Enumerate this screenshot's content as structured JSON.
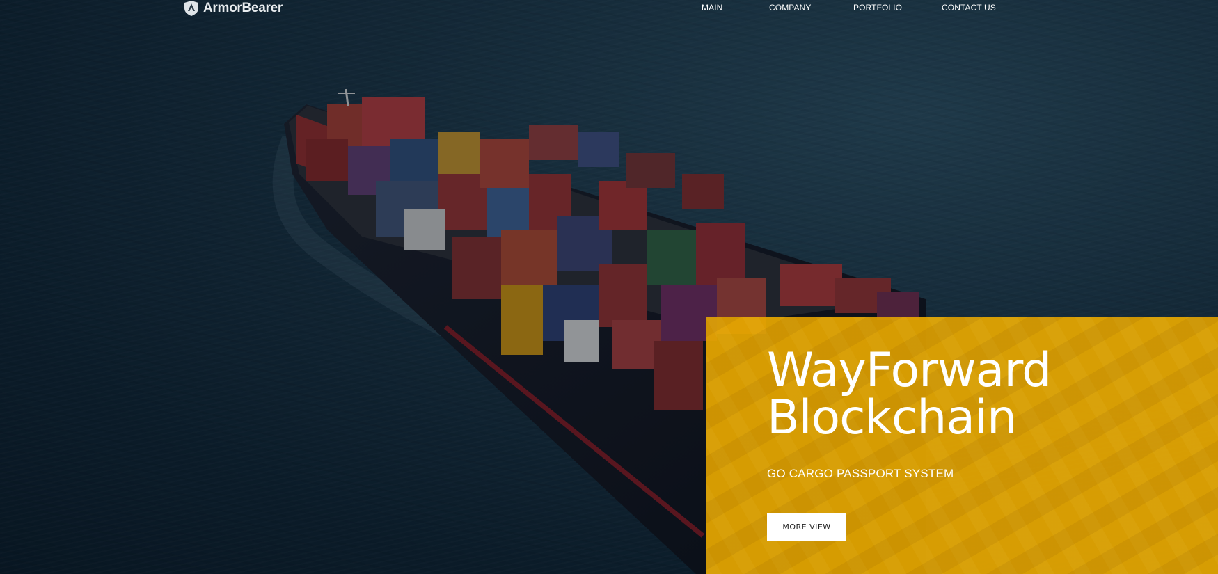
{
  "brand": {
    "name": "ArmorBearer",
    "logo_icon": "shield-logo-icon"
  },
  "nav": {
    "items": [
      {
        "label": "MAIN"
      },
      {
        "label": "COMPANY"
      },
      {
        "label": "PORTFOLIO"
      },
      {
        "label": "CONTACT US"
      }
    ]
  },
  "hero": {
    "background_image": "container-ship-aerial-photo",
    "headline_line1": "WayForward",
    "headline_line2": "Blockchain",
    "subtitle": "GO CARGO PASSPORT SYSTEM",
    "cta_label": "MORE VIEW",
    "accent_color": "#E8A800"
  }
}
